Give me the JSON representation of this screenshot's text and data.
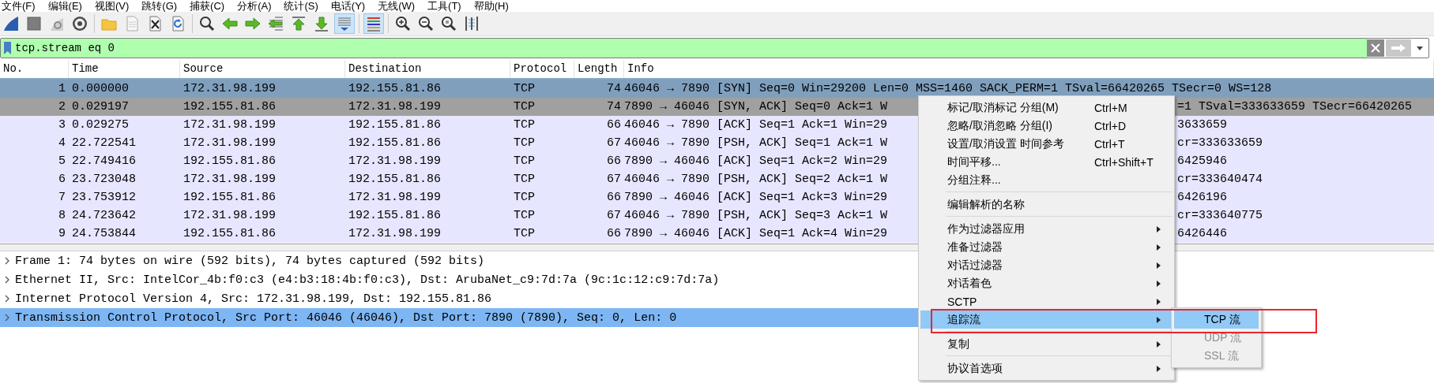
{
  "menubar": [
    "文件(F)",
    "编辑(E)",
    "视图(V)",
    "跳转(G)",
    "捕获(C)",
    "分析(A)",
    "统计(S)",
    "电话(Y)",
    "无线(W)",
    "工具(T)",
    "帮助(H)"
  ],
  "toolbar": [
    [
      {
        "kind": "start",
        "pressed": false
      },
      {
        "kind": "stop",
        "pressed": false
      },
      {
        "kind": "restart",
        "pressed": false
      },
      {
        "kind": "options",
        "pressed": false
      }
    ],
    [
      {
        "kind": "open",
        "pressed": false
      },
      {
        "kind": "file",
        "pressed": false
      },
      {
        "kind": "close",
        "pressed": false
      },
      {
        "kind": "reload",
        "pressed": false
      }
    ],
    [
      {
        "kind": "find",
        "pressed": false
      },
      {
        "kind": "back",
        "pressed": false
      },
      {
        "kind": "forward",
        "pressed": false
      },
      {
        "kind": "goto",
        "pressed": false
      },
      {
        "kind": "first",
        "pressed": false
      },
      {
        "kind": "last",
        "pressed": false
      },
      {
        "kind": "autoscroll",
        "pressed": true
      }
    ],
    [
      {
        "kind": "colorize",
        "pressed": true
      }
    ],
    [
      {
        "kind": "zoom_in",
        "pressed": false
      },
      {
        "kind": "zoom_out",
        "pressed": false
      },
      {
        "kind": "zoom_reset",
        "pressed": false
      },
      {
        "kind": "resize",
        "pressed": false
      }
    ]
  ],
  "filter": {
    "value": "tcp.stream eq 0"
  },
  "packet_list": {
    "columns": [
      "No.",
      "Time",
      "Source",
      "Destination",
      "Protocol",
      "Length",
      "Info"
    ],
    "rows": [
      {
        "no": "1",
        "time": "0.000000",
        "source": "172.31.98.199",
        "destination": "192.155.81.86",
        "protocol": "TCP",
        "length": "74",
        "info": "46046 → 7890 [SYN] Seq=0 Win=29200 Len=0 MSS=1460 SACK_PERM=1 TSval=66420265 TSecr=0 WS=128",
        "selected": true,
        "hovered": false
      },
      {
        "no": "2",
        "time": "0.029197",
        "source": "192.155.81.86",
        "destination": "172.31.98.199",
        "protocol": "TCP",
        "length": "74",
        "info": "7890 → 46046 [SYN, ACK] Seq=0 Ack=1 W",
        "info_tail": "=1 TSval=333633659 TSecr=66420265",
        "selected": false,
        "hovered": true
      },
      {
        "no": "3",
        "time": "0.029275",
        "source": "172.31.98.199",
        "destination": "192.155.81.86",
        "protocol": "TCP",
        "length": "66",
        "info": "46046 → 7890 [ACK] Seq=1 Ack=1 Win=29",
        "info_tail": "3633659",
        "selected": false,
        "hovered": false
      },
      {
        "no": "4",
        "time": "22.722541",
        "source": "172.31.98.199",
        "destination": "192.155.81.86",
        "protocol": "TCP",
        "length": "67",
        "info": "46046 → 7890 [PSH, ACK] Seq=1 Ack=1 W",
        "info_tail": "cr=333633659",
        "selected": false,
        "hovered": false
      },
      {
        "no": "5",
        "time": "22.749416",
        "source": "192.155.81.86",
        "destination": "172.31.98.199",
        "protocol": "TCP",
        "length": "66",
        "info": "7890 → 46046 [ACK] Seq=1 Ack=2 Win=29",
        "info_tail": "6425946",
        "selected": false,
        "hovered": false
      },
      {
        "no": "6",
        "time": "23.723048",
        "source": "172.31.98.199",
        "destination": "192.155.81.86",
        "protocol": "TCP",
        "length": "67",
        "info": "46046 → 7890 [PSH, ACK] Seq=2 Ack=1 W",
        "info_tail": "cr=333640474",
        "selected": false,
        "hovered": false
      },
      {
        "no": "7",
        "time": "23.753912",
        "source": "192.155.81.86",
        "destination": "172.31.98.199",
        "protocol": "TCP",
        "length": "66",
        "info": "7890 → 46046 [ACK] Seq=1 Ack=3 Win=29",
        "info_tail": "6426196",
        "selected": false,
        "hovered": false
      },
      {
        "no": "8",
        "time": "24.723642",
        "source": "172.31.98.199",
        "destination": "192.155.81.86",
        "protocol": "TCP",
        "length": "67",
        "info": "46046 → 7890 [PSH, ACK] Seq=3 Ack=1 W",
        "info_tail": "cr=333640775",
        "selected": false,
        "hovered": false
      },
      {
        "no": "9",
        "time": "24.753844",
        "source": "192.155.81.86",
        "destination": "172.31.98.199",
        "protocol": "TCP",
        "length": "66",
        "info": "7890 → 46046 [ACK] Seq=1 Ack=4 Win=29",
        "info_tail": "6426446",
        "selected": false,
        "hovered": false
      }
    ]
  },
  "details": [
    {
      "text": "Frame 1: 74 bytes on wire (592 bits), 74 bytes captured (592 bits)",
      "expanded": false,
      "selected": false
    },
    {
      "text": "Ethernet II, Src: IntelCor_4b:f0:c3 (e4:b3:18:4b:f0:c3), Dst: ArubaNet_c9:7d:7a (9c:1c:12:c9:7d:7a)",
      "expanded": false,
      "selected": false
    },
    {
      "text": "Internet Protocol Version 4, Src: 172.31.98.199, Dst: 192.155.81.86",
      "expanded": false,
      "selected": false
    },
    {
      "text": "Transmission Control Protocol, Src Port: 46046 (46046), Dst Port: 7890 (7890), Seq: 0, Len: 0",
      "expanded": false,
      "selected": true
    }
  ],
  "context_menu": {
    "items": [
      {
        "kind": "item",
        "label": "标记/取消标记 分组(M)",
        "shortcut": "Ctrl+M",
        "submenu": false,
        "selected": false
      },
      {
        "kind": "item",
        "label": "忽略/取消忽略 分组(I)",
        "shortcut": "Ctrl+D",
        "submenu": false,
        "selected": false
      },
      {
        "kind": "item",
        "label": "设置/取消设置 时间参考",
        "shortcut": "Ctrl+T",
        "submenu": false,
        "selected": false
      },
      {
        "kind": "item",
        "label": "时间平移...",
        "shortcut": "Ctrl+Shift+T",
        "submenu": false,
        "selected": false
      },
      {
        "kind": "item",
        "label": "分组注释...",
        "submenu": false,
        "selected": false
      },
      {
        "kind": "separator"
      },
      {
        "kind": "item",
        "label": "编辑解析的名称",
        "submenu": false,
        "selected": false
      },
      {
        "kind": "separator"
      },
      {
        "kind": "item",
        "label": "作为过滤器应用",
        "submenu": true,
        "selected": false
      },
      {
        "kind": "item",
        "label": "准备过滤器",
        "submenu": true,
        "selected": false
      },
      {
        "kind": "item",
        "label": "对话过滤器",
        "submenu": true,
        "selected": false
      },
      {
        "kind": "item",
        "label": "对话着色",
        "submenu": true,
        "selected": false
      },
      {
        "kind": "item",
        "label": "SCTP",
        "submenu": true,
        "selected": false
      },
      {
        "kind": "item",
        "label": "追踪流",
        "submenu": true,
        "selected": true,
        "annotated": true,
        "children": [
          {
            "label": "TCP 流",
            "selected": true,
            "disabled": false
          },
          {
            "label": "UDP 流",
            "selected": false,
            "disabled": true
          },
          {
            "label": "SSL 流",
            "selected": false,
            "disabled": true
          }
        ]
      },
      {
        "kind": "separator"
      },
      {
        "kind": "item",
        "label": "复制",
        "submenu": true,
        "selected": false
      },
      {
        "kind": "separator"
      },
      {
        "kind": "item",
        "label": "协议首选项",
        "submenu": true,
        "selected": false
      }
    ]
  }
}
